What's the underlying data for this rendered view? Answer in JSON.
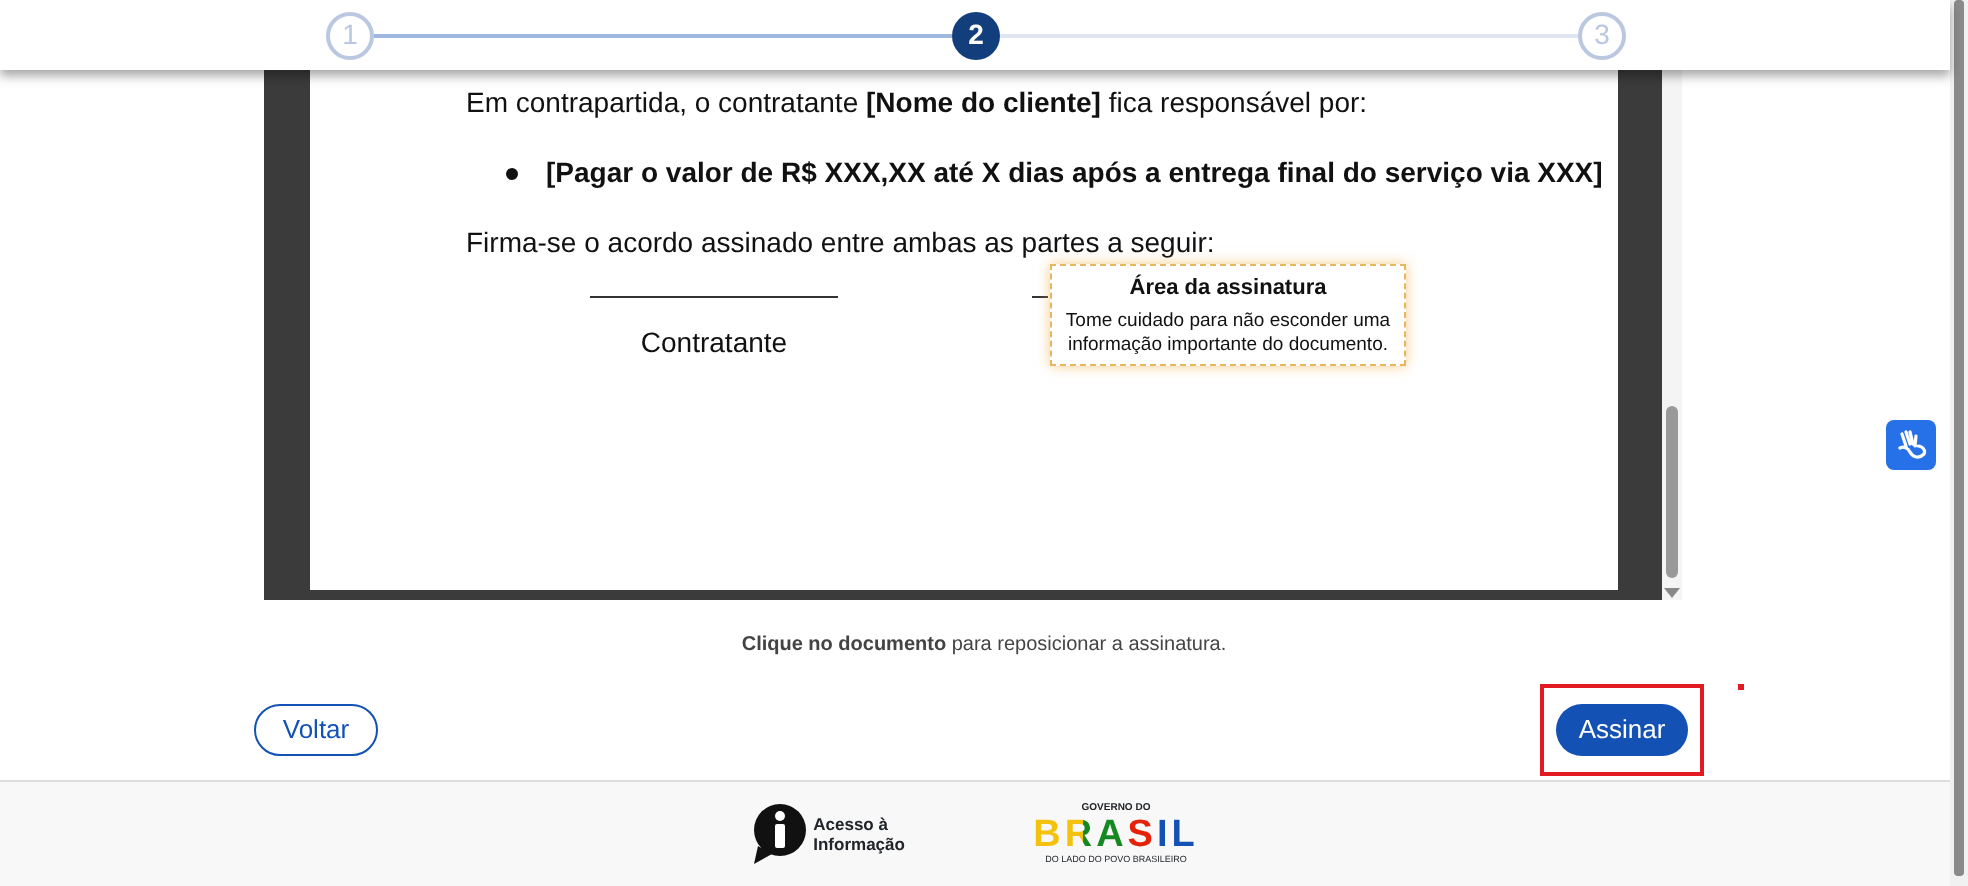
{
  "stepper": {
    "steps": [
      {
        "label": "1",
        "selected": false
      },
      {
        "label": "2",
        "selected": true
      },
      {
        "label": "3",
        "selected": false
      }
    ]
  },
  "document": {
    "blocks": [
      {
        "kind": "text",
        "text": "Em contrapartida, o contratante **[Nome do cliente]** fica responsável por:"
      },
      {
        "kind": "bullet",
        "text": "[Pagar o valor de R$ XXX,XX até X dias após a entrega final do serviço via XXX]"
      },
      {
        "kind": "text",
        "text": "Firma-se o acordo assinado entre ambas as partes a seguir:"
      }
    ],
    "signatures": [
      {
        "label": "Contratante",
        "covered": false
      },
      {
        "covered": true
      }
    ],
    "signature_area": {
      "title": "Área da assinatura",
      "body": "Tome cuidado para não esconder uma informação importante do documento."
    }
  },
  "hint": "**Clique no documento** para reposicionar a assinatura.",
  "buttons": [
    {
      "label": "Voltar",
      "kind": "outline",
      "highlighted": false
    },
    {
      "label": "Assinar",
      "kind": "primary",
      "highlighted": true
    }
  ],
  "footer": {
    "access_info": "Acesso à Informação",
    "gov_top": "GOVERNO DO",
    "gov_main": "BRASIL",
    "gov_bottom": "DO LADO DO POVO BRASILEIRO"
  }
}
